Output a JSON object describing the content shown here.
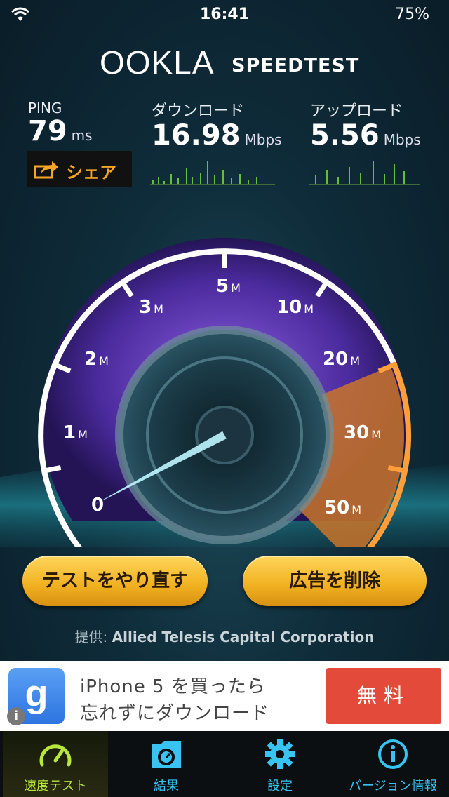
{
  "status": {
    "time": "16:41",
    "battery": "75%"
  },
  "header": {
    "logo": "OOKLA",
    "product": "SPEEDTEST"
  },
  "stats": {
    "ping": {
      "label": "PING",
      "value": "79",
      "unit": "ms"
    },
    "download": {
      "label": "ダウンロード",
      "value": "16.98",
      "unit": "Mbps"
    },
    "upload": {
      "label": "アップロード",
      "value": "5.56",
      "unit": "Mbps"
    }
  },
  "share": {
    "label": "シェア",
    "icon": "share-icon"
  },
  "gauge": {
    "ticks": [
      {
        "num": "0",
        "unit": ""
      },
      {
        "num": "1",
        "unit": "M"
      },
      {
        "num": "2",
        "unit": "M"
      },
      {
        "num": "3",
        "unit": "M"
      },
      {
        "num": "5",
        "unit": "M"
      },
      {
        "num": "10",
        "unit": "M"
      },
      {
        "num": "20",
        "unit": "M"
      },
      {
        "num": "30",
        "unit": "M"
      },
      {
        "num": "50",
        "unit": "M"
      }
    ],
    "needle_value_mbps": 0.5,
    "accent_purple": "#6b3fc4",
    "accent_orange": "#e8862a"
  },
  "buttons": {
    "retry": "テストをやり直す",
    "remove_ads": "広告を削除"
  },
  "provider": {
    "prefix": "提供:",
    "name": "Allied Telesis Capital Corporation"
  },
  "ad": {
    "line1": "iPhone 5 を買ったら",
    "line2": "忘れずにダウンロード",
    "cta": "無料",
    "icon": "google-search-icon"
  },
  "tabs": [
    {
      "label": "速度テスト",
      "icon": "speedometer-icon",
      "active": true
    },
    {
      "label": "結果",
      "icon": "results-folder-icon",
      "active": false
    },
    {
      "label": "設定",
      "icon": "gear-icon",
      "active": false
    },
    {
      "label": "バージョン情報",
      "icon": "info-icon",
      "active": false
    }
  ]
}
